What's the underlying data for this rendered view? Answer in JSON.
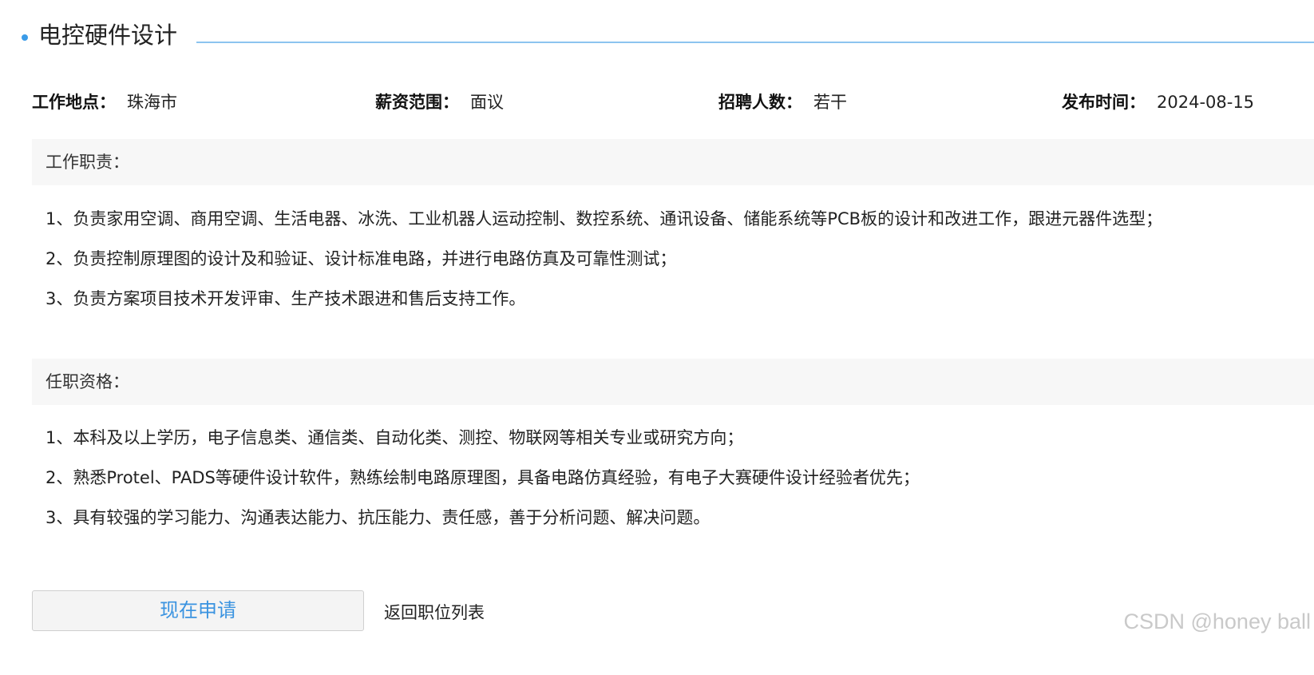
{
  "job": {
    "title": "电控硬件设计"
  },
  "meta": [
    {
      "label": "工作地点：",
      "value": "珠海市"
    },
    {
      "label": "薪资范围：",
      "value": "面议"
    },
    {
      "label": "招聘人数：",
      "value": "若干"
    },
    {
      "label": "发布时间：",
      "value": "2024-08-15"
    }
  ],
  "duties": {
    "heading": "工作职责：",
    "items": [
      "1、负责家用空调、商用空调、生活电器、冰洗、工业机器人运动控制、数控系统、通讯设备、储能系统等PCB板的设计和改进工作，跟进元器件选型；",
      "2、负责控制原理图的设计及和验证、设计标准电路，并进行电路仿真及可靠性测试；",
      "3、负责方案项目技术开发评审、生产技术跟进和售后支持工作。"
    ]
  },
  "requirements": {
    "heading": "任职资格：",
    "items": [
      "1、本科及以上学历，电子信息类、通信类、自动化类、测控、物联网等相关专业或研究方向；",
      "2、熟悉Protel、PADS等硬件设计软件，熟练绘制电路原理图，具备电路仿真经验，有电子大赛硬件设计经验者优先；",
      "3、具有较强的学习能力、沟通表达能力、抗压能力、责任感，善于分析问题、解决问题。"
    ]
  },
  "actions": {
    "apply_label": "现在申请",
    "back_label": "返回职位列表"
  },
  "watermark": "CSDN @honey ball",
  "colors": {
    "accent": "#3a9be8",
    "button_text": "#3a93e0",
    "section_bg": "#f7f7f7"
  }
}
